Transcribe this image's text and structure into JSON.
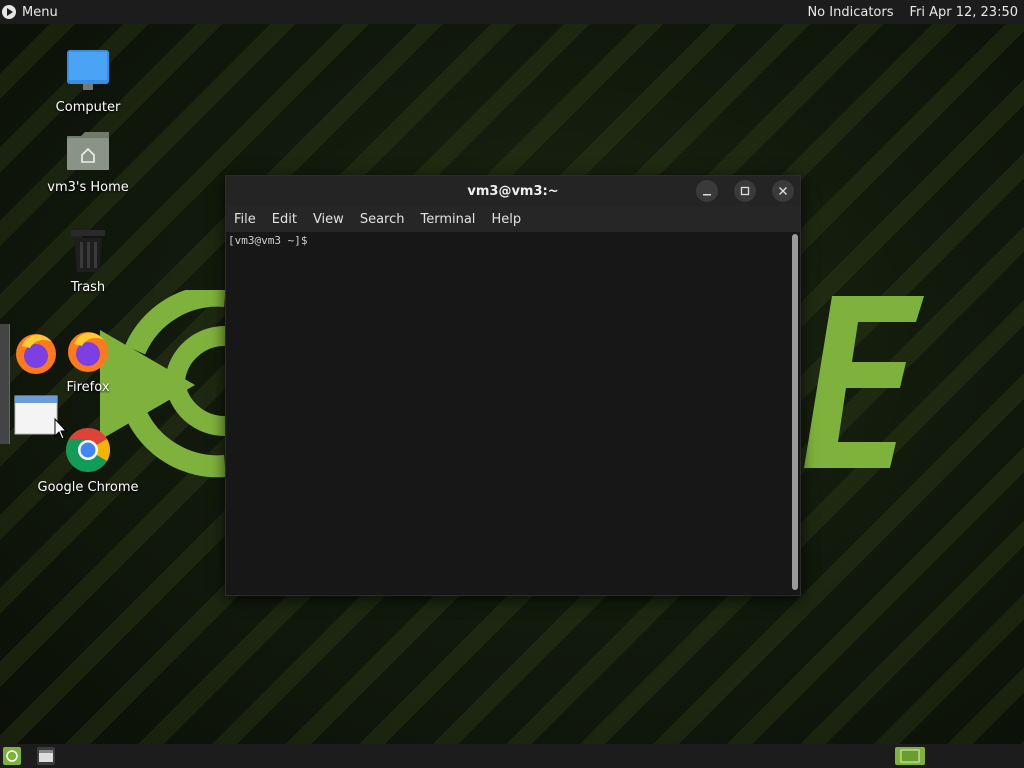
{
  "top_panel": {
    "menu_label": "Menu",
    "indicators_label": "No Indicators",
    "clock": "Fri Apr 12, 23:50"
  },
  "desktop": {
    "icons": [
      {
        "label": "Computer",
        "icon": "computer-icon"
      },
      {
        "label": "vm3's Home",
        "icon": "home-folder-icon"
      },
      {
        "label": "Trash",
        "icon": "trash-icon"
      },
      {
        "label": "Firefox",
        "icon": "firefox-icon"
      },
      {
        "label": "Google Chrome",
        "icon": "chrome-icon"
      }
    ]
  },
  "terminal": {
    "title": "vm3@vm3:~",
    "menu": [
      "File",
      "Edit",
      "View",
      "Search",
      "Terminal",
      "Help"
    ],
    "prompt": "[vm3@vm3 ~]$"
  },
  "colors": {
    "accent_green": "#8bc34a",
    "panel_bg": "#1c1c1c",
    "terminal_bg": "#171717"
  }
}
